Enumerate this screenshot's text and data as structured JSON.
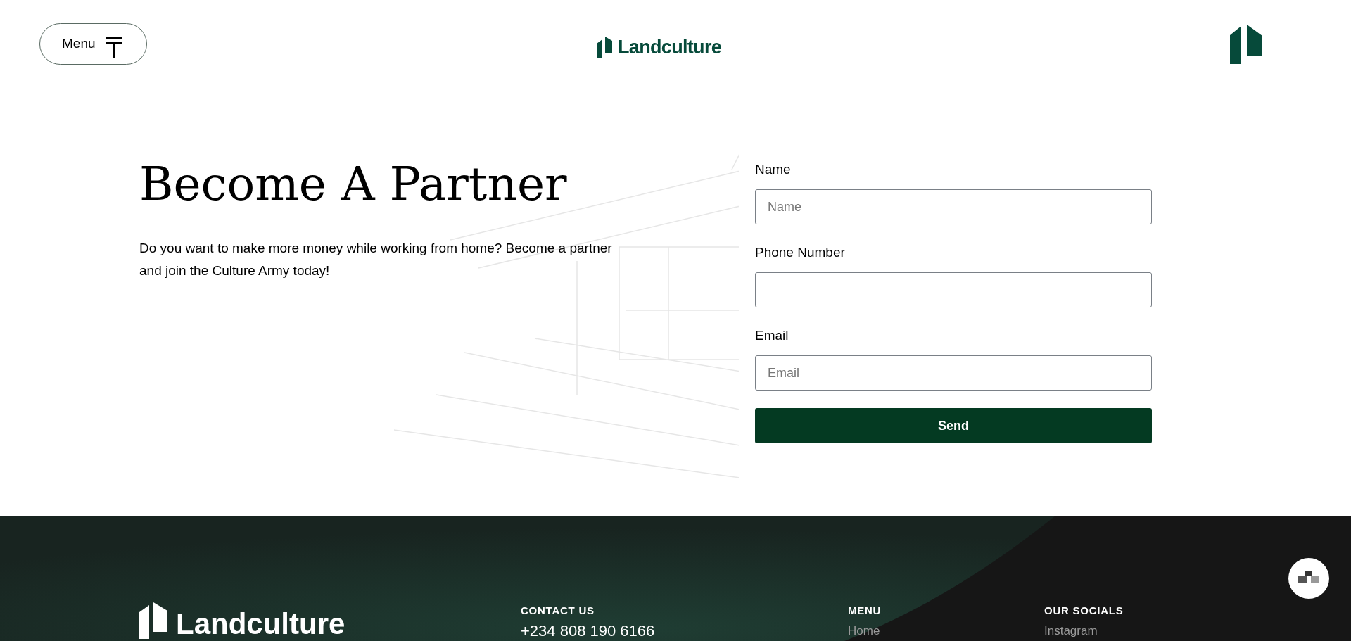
{
  "header": {
    "menu_button": "Menu",
    "logo": "Landculture"
  },
  "hero": {
    "title": "Become A Partner",
    "text": "Do you want to make more money while working from home? Become a partner and join the Culture Army today!"
  },
  "form": {
    "fields": [
      {
        "label": "Name",
        "placeholder": "Name"
      },
      {
        "label": "Phone Number"
      },
      {
        "label": "Email",
        "placeholder": "Email"
      }
    ],
    "submit": "Send"
  },
  "footer": {
    "logo": "Landculture",
    "columns": [
      {
        "heading": "CONTACT US",
        "items": [
          "+234 808 190 6166"
        ]
      },
      {
        "heading": "MENU",
        "items": [
          "Home"
        ]
      },
      {
        "heading": "OUR SOCIALS",
        "items": [
          "Instagram"
        ]
      }
    ]
  }
}
